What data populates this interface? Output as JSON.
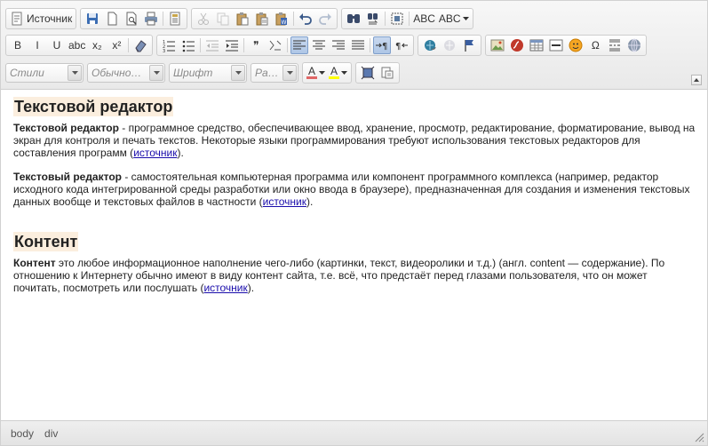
{
  "toolbar": {
    "row1": [
      {
        "name": "source-group",
        "buttons": [
          {
            "icon": "source-icon",
            "label": "Источник"
          }
        ]
      },
      {
        "name": "document-group",
        "buttons": [
          {
            "icon": "save-icon"
          },
          {
            "icon": "new-page-icon"
          },
          {
            "icon": "preview-icon"
          },
          {
            "icon": "print-icon"
          },
          {
            "sep": true
          },
          {
            "icon": "templates-icon"
          }
        ]
      },
      {
        "name": "clipboard-group",
        "buttons": [
          {
            "icon": "cut-icon",
            "disabled": true
          },
          {
            "icon": "copy-icon",
            "disabled": true
          },
          {
            "icon": "paste-icon"
          },
          {
            "icon": "paste-text-icon"
          },
          {
            "icon": "paste-word-icon"
          },
          {
            "sep": true
          },
          {
            "icon": "undo-icon"
          },
          {
            "icon": "redo-icon",
            "disabled": true
          }
        ]
      },
      {
        "name": "editing-group",
        "buttons": [
          {
            "icon": "find-icon"
          },
          {
            "icon": "replace-icon"
          },
          {
            "sep": true
          },
          {
            "icon": "select-all-icon"
          },
          {
            "sep": true
          },
          {
            "icon": "spellcheck-icon",
            "text": "ABC"
          },
          {
            "icon": "spellcheck-dropdown-icon",
            "text": "ABC",
            "dropdown": true
          }
        ]
      }
    ],
    "row2": [
      {
        "name": "basic-styles-group",
        "buttons": [
          {
            "icon": "bold-icon",
            "text": "B"
          },
          {
            "icon": "italic-icon",
            "text": "I"
          },
          {
            "icon": "underline-icon",
            "text": "U"
          },
          {
            "icon": "strike-icon",
            "text": "abc"
          },
          {
            "icon": "subscript-icon",
            "text": "x₂"
          },
          {
            "icon": "superscript-icon",
            "text": "x²"
          },
          {
            "sep": true
          },
          {
            "icon": "remove-format-icon"
          }
        ]
      },
      {
        "name": "paragraph-group",
        "buttons": [
          {
            "icon": "numbered-list-icon"
          },
          {
            "icon": "bulleted-list-icon"
          },
          {
            "sep": true
          },
          {
            "icon": "outdent-icon",
            "disabled": true
          },
          {
            "icon": "indent-icon"
          },
          {
            "sep": true
          },
          {
            "icon": "blockquote-icon",
            "text": "❞"
          },
          {
            "icon": "create-div-icon"
          },
          {
            "sep": true
          },
          {
            "icon": "align-left-icon",
            "active": true
          },
          {
            "icon": "align-center-icon"
          },
          {
            "icon": "align-right-icon"
          },
          {
            "icon": "align-justify-icon"
          },
          {
            "sep": true
          },
          {
            "icon": "ltr-icon",
            "active": true
          },
          {
            "icon": "rtl-icon"
          }
        ]
      },
      {
        "name": "links-group",
        "buttons": [
          {
            "icon": "link-icon"
          },
          {
            "icon": "unlink-icon",
            "disabled": true
          },
          {
            "icon": "anchor-icon"
          }
        ]
      },
      {
        "name": "insert-group",
        "buttons": [
          {
            "icon": "image-icon"
          },
          {
            "icon": "flash-icon"
          },
          {
            "icon": "table-icon"
          },
          {
            "icon": "horizontal-rule-icon"
          },
          {
            "icon": "smiley-icon"
          },
          {
            "icon": "special-char-icon",
            "text": "Ω"
          },
          {
            "icon": "page-break-icon"
          },
          {
            "icon": "iframe-icon"
          }
        ]
      }
    ],
    "row3": {
      "combos": [
        {
          "name": "styles-combo",
          "value": "Стили",
          "width": 88
        },
        {
          "name": "format-combo",
          "value": "Обычно…",
          "width": 88
        },
        {
          "name": "font-combo",
          "value": "Шрифт",
          "width": 88
        },
        {
          "name": "size-combo",
          "value": "Ра…",
          "width": 54
        }
      ],
      "color_group": [
        {
          "icon": "text-color-icon",
          "text": "A",
          "color": "#e06666"
        },
        {
          "icon": "bg-color-icon",
          "text": "A",
          "color": "#ffff00"
        }
      ],
      "tools_group": [
        {
          "icon": "maximize-icon"
        },
        {
          "icon": "show-blocks-icon"
        }
      ]
    }
  },
  "content": {
    "h1": "Текстовой редактор",
    "p1_term": "Текстовой редактор",
    "p1_text": " - программное средство, обеспечивающее ввод, хранение, просмотр, редактирование, форматирование, вывод на экран для контроля и печать текстов. Некоторые языки программирования требуют использования текстовых редакторов для составления программ (",
    "p1_link": "источник",
    "p1_end": ").",
    "p2_term": "Текстовый редактор",
    "p2_text": " - самостоятельная компьютерная программа или компонент программного комплекса (например, редактор исходного кода интегрированной среды разработки или окно ввода в браузере), предназначенная для создания и изменения текстовых данных вообще и текстовых файлов в частности (",
    "p2_link": "источник",
    "p2_end": ").",
    "h2": "Контент",
    "p3_term": "Контент",
    "p3_text": " это любое информационное наполнение чего-либо (картинки, текст, видеоролики и т.д.) (англ. content — содержание). По отношению к Интернету обычно имеют в виду контент сайта, т.е. всё, что предстаёт перед глазами пользователя, что он может почитать, посмотреть или послушать (",
    "p3_link": "источник",
    "p3_end": ")."
  },
  "statusbar": {
    "path": [
      "body",
      "div"
    ]
  }
}
